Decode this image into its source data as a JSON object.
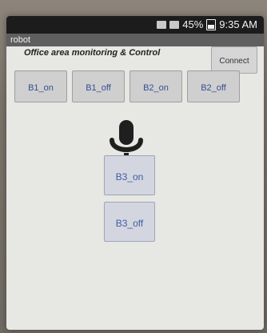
{
  "status_bar": {
    "left_indicator": "",
    "battery_percent": "45%",
    "time": "9:35 AM"
  },
  "app_title": "robot",
  "header": {
    "text": "Office area monitoring & Control",
    "connect_label": "Connect"
  },
  "bulb_buttons": [
    "B1_on",
    "B1_off",
    "B2_on",
    "B2_off"
  ],
  "voice_icon": "microphone-icon",
  "b3_buttons": {
    "on_label": "B3_on",
    "off_label": "B3_off"
  },
  "colors": {
    "button_text": "#3e5fa4",
    "status_bar": "#1c1c1c",
    "app_bar": "#5f5f5f",
    "screen_bg": "#e7e7e3"
  }
}
